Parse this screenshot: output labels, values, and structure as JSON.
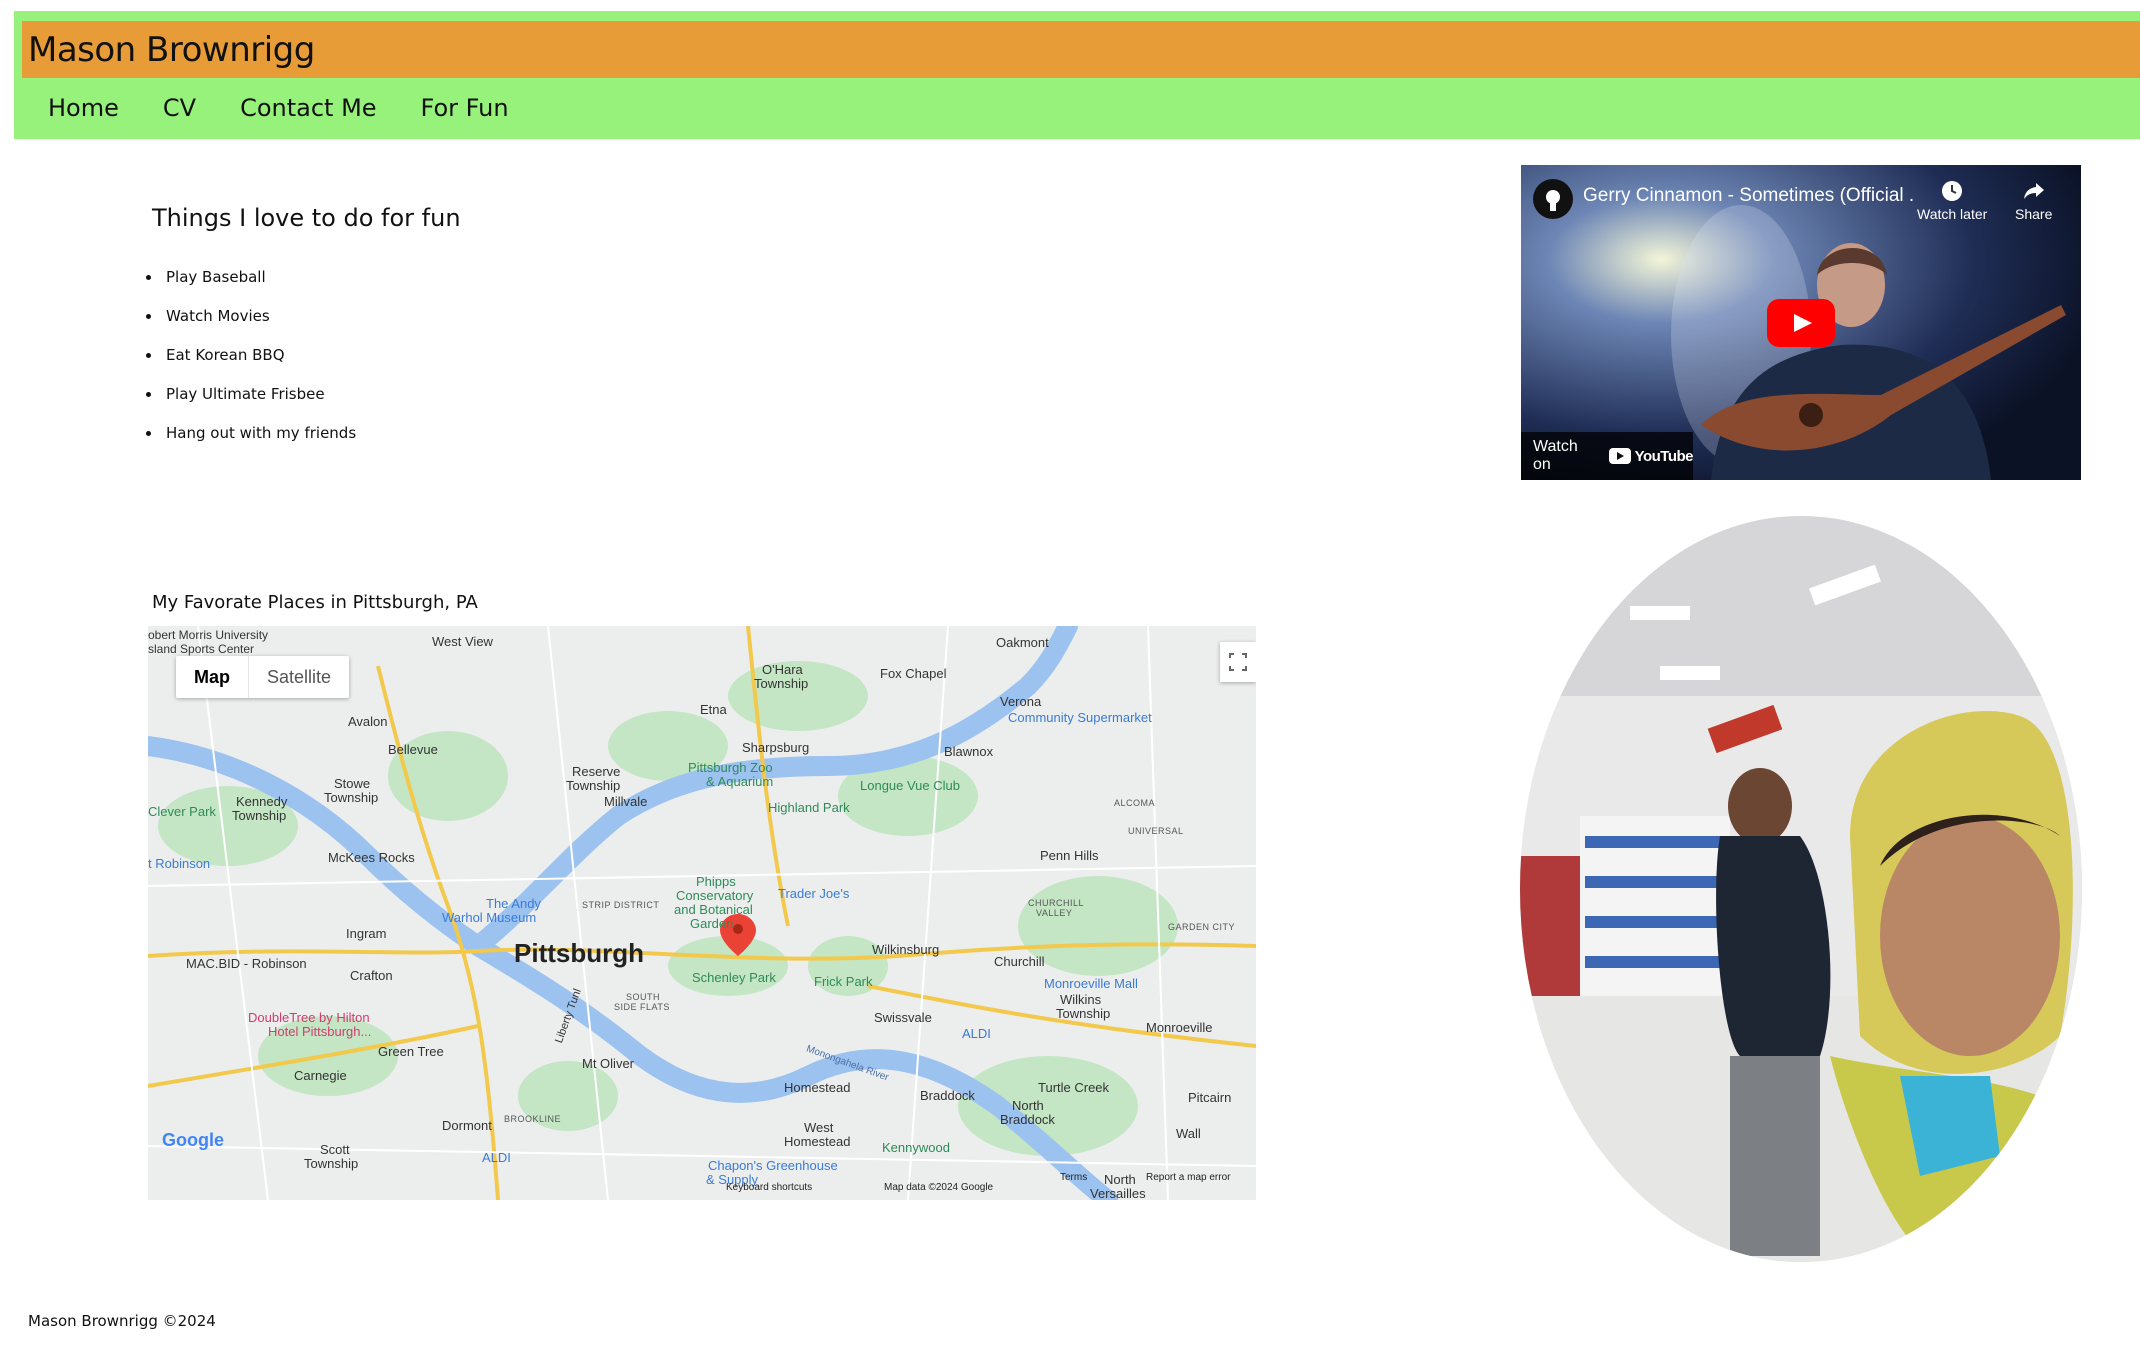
{
  "site": {
    "title": "Mason Brownrigg"
  },
  "nav": {
    "items": [
      {
        "label": "Home"
      },
      {
        "label": "CV"
      },
      {
        "label": "Contact Me"
      },
      {
        "label": "For Fun"
      }
    ]
  },
  "fun": {
    "heading": "Things I love to do for fun",
    "items": [
      "Play Baseball",
      "Watch Movies",
      "Eat Korean BBQ",
      "Play Ultimate Frisbee",
      "Hang out with my friends"
    ]
  },
  "map": {
    "heading": "My Favorate Places in Pittsburgh, PA",
    "type_map": "Map",
    "type_satellite": "Satellite",
    "labels": {
      "pittsburgh": "Pittsburgh",
      "west_view": "West View",
      "oakmont": "Oakmont",
      "ohara": "O'Hara",
      "ohara2": "Township",
      "fox_chapel": "Fox Chapel",
      "etna": "Etna",
      "verona": "Verona",
      "community_supermarket": "Community Supermarket",
      "avalon": "Avalon",
      "bellevue": "Bellevue",
      "sharpsburg": "Sharpsburg",
      "blawnox": "Blawnox",
      "reserve": "Reserve",
      "reserve2": "Township",
      "millvale": "Millvale",
      "zoo": "Pittsburgh Zoo",
      "zoo2": "& Aquarium",
      "longue_vue": "Longue Vue Club",
      "stowe": "Stowe",
      "stowe2": "Township",
      "kennedy": "Kennedy",
      "kennedy2": "Township",
      "clever_park": "Clever Park",
      "highland_park": "Highland Park",
      "robinson": "t Robinson",
      "mckees_rocks": "McKees Rocks",
      "phipps": "Phipps",
      "phipps2": "Conservatory",
      "phipps3": "and Botanical",
      "phipps4": "Garden",
      "trader_joes": "Trader Joe's",
      "penn_hills": "Penn Hills",
      "the_andy": "The Andy",
      "the_andy2": "Warhol Museum",
      "ingram": "Ingram",
      "wilkinsburg": "Wilkinsburg",
      "churchill": "Churchill",
      "mac_bid": "MAC.BID - Robinson",
      "crafton": "Crafton",
      "schenley_park": "Schenley Park",
      "frick_park": "Frick Park",
      "monroeville_mall": "Monroeville Mall",
      "wilkins": "Wilkins",
      "wilkins2": "Township",
      "doubletree": "DoubleTree by Hilton",
      "doubletree2": "Hotel Pittsburgh...",
      "swissvale": "Swissvale",
      "monroeville": "Monroeville",
      "green_tree": "Green Tree",
      "aldi": "ALDI",
      "mt_oliver": "Mt Oliver",
      "carnegie": "Carnegie",
      "homestead": "Homestead",
      "braddock": "Braddock",
      "turtle_creek": "Turtle Creek",
      "pitcairn": "Pitcairn",
      "north_braddock": "North",
      "north_braddock2": "Braddock",
      "dormont": "Dormont",
      "west_homestead": "West",
      "west_homestead2": "Homestead",
      "wall": "Wall",
      "scott": "Scott",
      "scott2": "Township",
      "aldi2": "ALDI",
      "kennywood": "Kennywood",
      "chapons": "Chapon's Greenhouse",
      "chapons2": "& Supply",
      "north_versailles": "North",
      "north_versailles2": "Versailles",
      "strip_district": "STRIP DISTRICT",
      "south_side": "SOUTH",
      "south_side2": "SIDE FLATS",
      "alcoma": "ALCOMA",
      "universal": "UNIVERSAL",
      "churchill_valley": "CHURCHILL",
      "churchill_valley2": "VALLEY",
      "garden_city": "GARDEN CITY",
      "brookline": "BROOKLINE",
      "robert_morris": "obert Morris University",
      "robert_morris2": "sland Sports Center",
      "liberty_tunnel": "Liberty Tunl",
      "monongahela": "Monongahela River"
    },
    "footer": {
      "keyboard": "Keyboard shortcuts",
      "map_data": "Map data ©2024 Google",
      "terms": "Terms",
      "report": "Report a map error",
      "google": "Google"
    }
  },
  "video": {
    "title": "Gerry Cinnamon - Sometimes (Official ...",
    "watch_later": "Watch later",
    "share": "Share",
    "watch_on": "Watch on",
    "youtube": "YouTube"
  },
  "footer": {
    "text": "Mason Brownrigg ©2024"
  },
  "colors": {
    "nav_band": "#96f27a",
    "title_bar": "#e89c38"
  }
}
